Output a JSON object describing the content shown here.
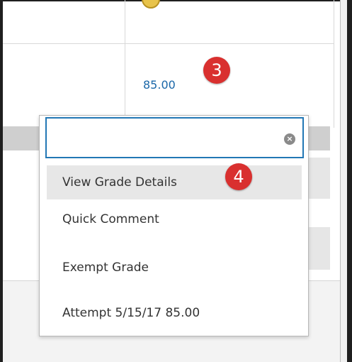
{
  "grade": {
    "value": "85.00"
  },
  "callouts": {
    "step3": "3",
    "step4": "4"
  },
  "menu": {
    "search": {
      "value": "",
      "placeholder": ""
    },
    "items": [
      {
        "label": "View Grade Details",
        "active": true
      },
      {
        "label": "Quick Comment",
        "active": false
      },
      {
        "label": "Exempt Grade",
        "active": false
      },
      {
        "label": "Attempt 5/15/17 85.00",
        "active": false
      }
    ]
  },
  "icons": {
    "clear": "clear-circle-icon",
    "status": "grade-status-icon"
  },
  "colors": {
    "link": "#1a67a8",
    "badge": "#d9302f",
    "focus": "#2277b5",
    "active_item": "#e7e7e7"
  }
}
